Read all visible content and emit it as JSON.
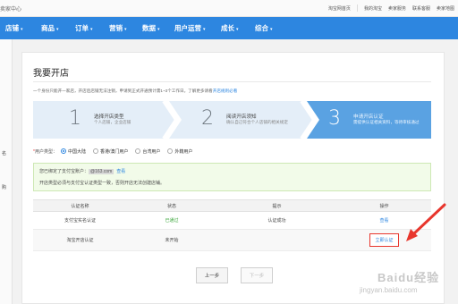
{
  "topbar": {
    "brand": "卖家中心",
    "links": [
      "淘宝网首页",
      "我的淘宝",
      "卖家服务",
      "联系客服",
      "卖家地图"
    ]
  },
  "nav": {
    "items": [
      "店铺",
      "商品",
      "订单",
      "营销",
      "数据",
      "用户运营",
      "成长",
      "综合"
    ]
  },
  "sidebar": {
    "items": [
      "名",
      "购"
    ]
  },
  "page": {
    "title": "我要开店",
    "description": "一个身份只能开一家店，开店后店铺无法注销，申请到正式开通预计需1~3个工作日。了解更多请看",
    "description_link": "开店规则必看"
  },
  "steps": [
    {
      "num": "1",
      "title": "选择开店类型",
      "subtitle": "个人店铺，企业店铺"
    },
    {
      "num": "2",
      "title": "阅读开店须知",
      "subtitle": "确认自己符合个人店铺的相关规定"
    },
    {
      "num": "3",
      "title": "申请开店认证",
      "subtitle": "需提供认证相关资料，等待审核通过"
    }
  ],
  "user_type": {
    "label": "用户类型：",
    "required_mark": "*",
    "options": [
      "中国大陆",
      "香港/澳门用户",
      "台湾用户",
      "外籍用户"
    ],
    "selected": "中国大陆"
  },
  "notice": {
    "line1_prefix": "您已绑定了支付宝账户：",
    "email": "@163.com",
    "line1_link": "查看",
    "line2": "开店类型必须与支付宝认证类型一致，否则开店无法创建店铺。"
  },
  "table": {
    "headers": [
      "认证名称",
      "状态",
      "提示",
      "操作"
    ],
    "rows": [
      {
        "name": "支付宝实名认证",
        "status": "已通过",
        "tip": "认证成功",
        "action": "查看"
      },
      {
        "name": "淘宝开店认证",
        "status": "未开始",
        "tip": "",
        "action": "立即认证"
      }
    ]
  },
  "buttons": {
    "prev": "上一步",
    "next": "下一步"
  },
  "colors": {
    "nav_blue": "#2d86e0",
    "step_active": "#5aa2e2",
    "step_inactive": "#e4eef8",
    "highlight_red": "#e8362d",
    "success_green": "#3aa63a"
  },
  "watermark": {
    "logo": "Baidu经验",
    "url": "jingyan.baidu.com"
  }
}
